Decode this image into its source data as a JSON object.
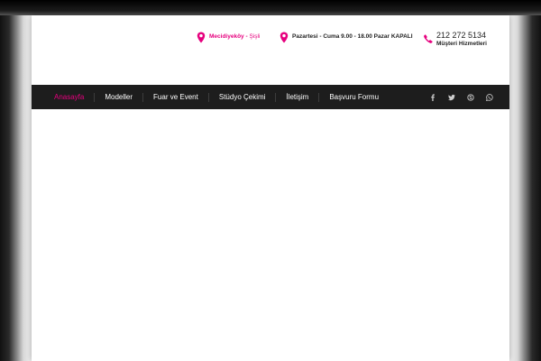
{
  "header": {
    "location": {
      "label": "Mecidiyeköy",
      "separator": " - ",
      "district": "Şişli",
      "icon": "map-pin-icon"
    },
    "hours": {
      "text": "Pazartesi - Cuma 9.00 - 18.00 Pazar KAPALI",
      "icon": "map-pin-icon"
    },
    "phone": {
      "number": "212 272 5134",
      "label": "Müşteri Hizmetleri",
      "icon": "phone-icon"
    }
  },
  "nav": {
    "items": [
      {
        "label": "Anasayfa",
        "active": true
      },
      {
        "label": "Modeller"
      },
      {
        "label": "Fuar ve Event"
      },
      {
        "label": "Stüdyo Çekimi"
      },
      {
        "label": "İletişim"
      },
      {
        "label": "Başvuru Formu"
      }
    ],
    "social": [
      "facebook-icon",
      "twitter-icon",
      "skype-icon",
      "whatsapp-icon"
    ]
  },
  "colors": {
    "accent": "#e6007e",
    "nav_bg": "#1d1d1d",
    "text": "#222222"
  }
}
